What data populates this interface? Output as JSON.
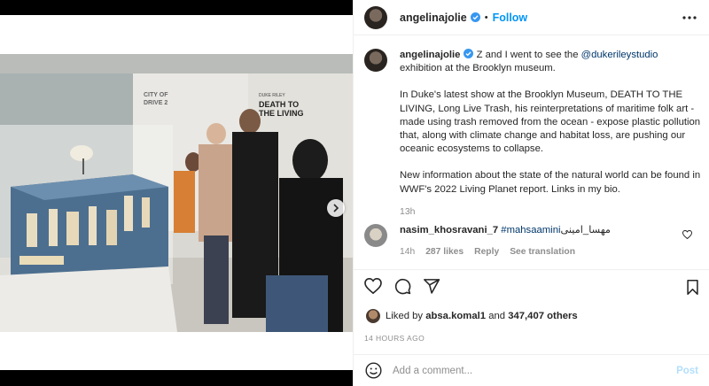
{
  "post": {
    "author": "angelinajolie",
    "follow_label": "Follow",
    "dot": "•",
    "caption": {
      "username": "angelinajolie",
      "line1_pre": " Z and I went to see the ",
      "mention": "@dukerileystudio",
      "line1_post": " exhibition at the Brooklyn museum.",
      "para2": "In Duke's latest show at the Brooklyn Museum, DEATH TO THE LIVING, Long Live Trash, his reinterpretations of maritime folk art - made using trash removed from the ocean - expose plastic pollution that, along with climate change and habitat loss, are pushing our oceanic ecosystems to collapse.",
      "para3": "New information about the state of the natural world can be found in WWF's 2022 Living Planet report. Links in my bio.",
      "time": "13h"
    },
    "comment": {
      "username": "nasim_khosravani_7",
      "hashtag": "#mahsaamini",
      "text_fa": "مهسا_امینی",
      "time": "14h",
      "likes": "287 likes",
      "reply": "Reply",
      "translate": "See translation"
    },
    "likes": {
      "prefix": "Liked by ",
      "user": "absa.komal1",
      "and": " and ",
      "count": "347,407 others"
    },
    "ago": "14 HOURS AGO",
    "add_comment_placeholder": "Add a comment...",
    "post_label": "Post",
    "photo": {
      "sign_line1": "DEATH TO",
      "sign_line2": "THE LIVING",
      "sign_sub": "DUKE RILEY"
    }
  },
  "colors": {
    "accent": "#0095f6",
    "link": "#00376b",
    "muted": "#8e8e8e",
    "post_disabled": "#b2dffc"
  }
}
